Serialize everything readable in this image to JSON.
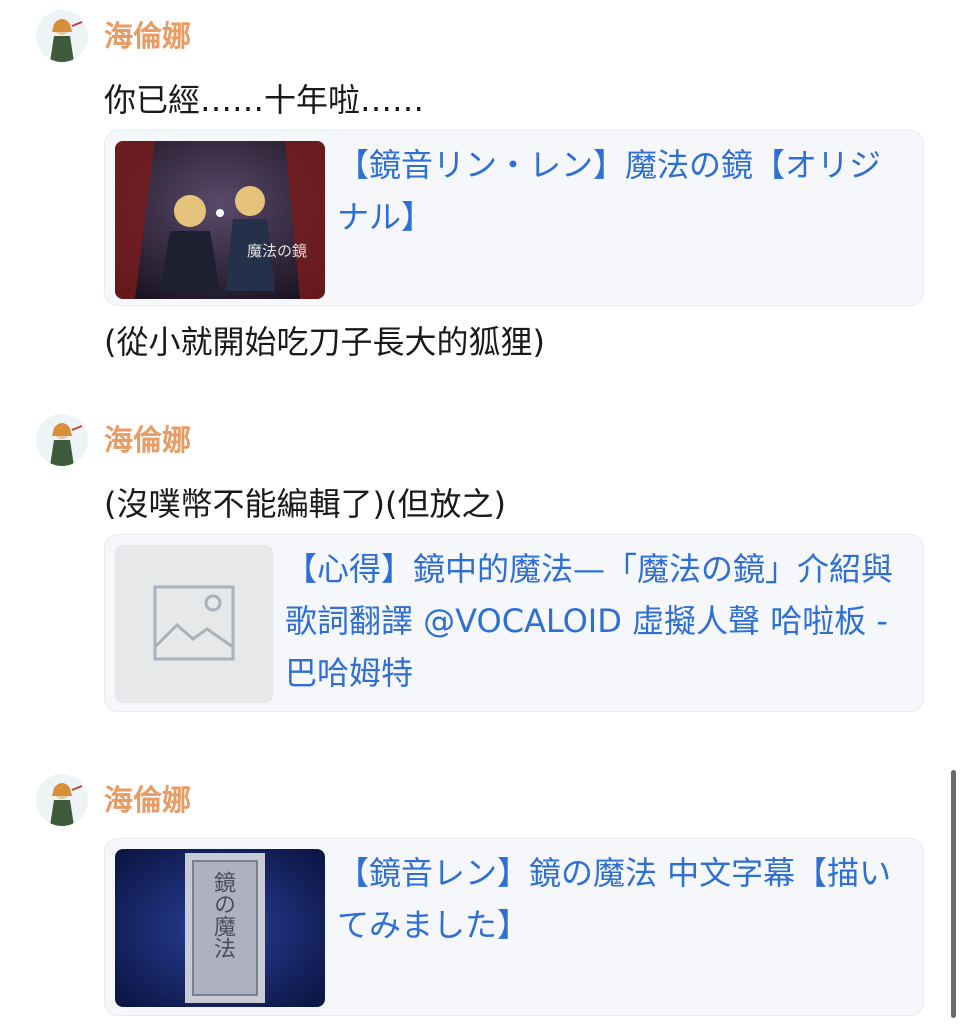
{
  "messages": [
    {
      "author": "海倫娜",
      "lines": [
        "你已經……十年啦……"
      ],
      "card": {
        "title": "【鏡音リン・レン】魔法の鏡【オリジナル】",
        "thumb_caption": "魔法の鏡"
      },
      "after": [
        "(從小就開始吃刀子長大的狐狸)"
      ]
    },
    {
      "author": "海倫娜",
      "lines": [
        "(沒噗幣不能編輯了)(但放之)"
      ],
      "card": {
        "title": "【心得】鏡中的魔法—「魔法の鏡」介紹與歌詞翻譯 @VOCALOID 虛擬人聲 哈啦板 - 巴哈姆特",
        "thumb_icon": "image-placeholder-icon"
      },
      "after": []
    },
    {
      "author": "海倫娜",
      "lines": [],
      "card": {
        "title": "【鏡音レン】鏡の魔法 中文字幕【描いてみました】",
        "thumb_caption": "鏡の魔法"
      },
      "after": []
    }
  ],
  "colors": {
    "author": "#e89b62",
    "link": "#2f6fd4",
    "card_bg": "#f5f7fb"
  }
}
